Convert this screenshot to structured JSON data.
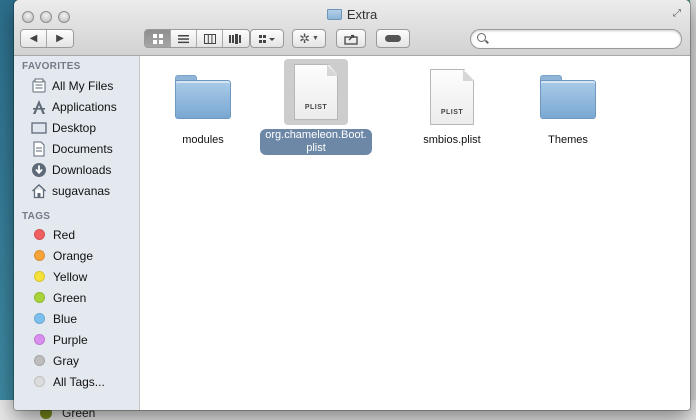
{
  "window": {
    "title": "Extra"
  },
  "toolbar": {
    "back_icon": "chevron-left-icon",
    "forward_icon": "chevron-right-icon",
    "view_modes": [
      "icon-view-icon",
      "list-view-icon",
      "column-view-icon",
      "coverflow-view-icon"
    ],
    "active_view": "icon-view-icon",
    "arrange_icon": "arrange-grid-icon",
    "action_icon": "gear-icon",
    "share_icon": "share-icon",
    "tags_icon": "tag-icon",
    "search": {
      "value": "",
      "placeholder": ""
    }
  },
  "sidebar": {
    "favorites_heading": "FAVORITES",
    "favorites": [
      {
        "label": "All My Files",
        "icon": "all-files-icon"
      },
      {
        "label": "Applications",
        "icon": "applications-icon"
      },
      {
        "label": "Desktop",
        "icon": "desktop-icon"
      },
      {
        "label": "Documents",
        "icon": "documents-icon"
      },
      {
        "label": "Downloads",
        "icon": "downloads-icon"
      },
      {
        "label": "sugavanas",
        "icon": "home-icon"
      }
    ],
    "tags_heading": "TAGS",
    "tags": [
      {
        "label": "Red",
        "color": "#f0605f"
      },
      {
        "label": "Orange",
        "color": "#f7a33a"
      },
      {
        "label": "Yellow",
        "color": "#f4e13a"
      },
      {
        "label": "Green",
        "color": "#a8d43a"
      },
      {
        "label": "Blue",
        "color": "#7dc0f0"
      },
      {
        "label": "Purple",
        "color": "#d98ef0"
      },
      {
        "label": "Gray",
        "color": "#bdbdbd"
      },
      {
        "label": "All Tags...",
        "color": "#dcdcdc"
      }
    ]
  },
  "files": [
    {
      "name": "modules",
      "kind": "folder",
      "selected": false
    },
    {
      "name": "org.chameleon.Boot.plist",
      "kind": "document",
      "badge": "PLIST",
      "selected": true
    },
    {
      "name": "smbios.plist",
      "kind": "document",
      "badge": "PLIST",
      "selected": false
    },
    {
      "name": "Themes",
      "kind": "folder",
      "selected": false
    }
  ],
  "background": {
    "partial_item_label": "Green",
    "partial_item_color": "#7a8c1c"
  }
}
